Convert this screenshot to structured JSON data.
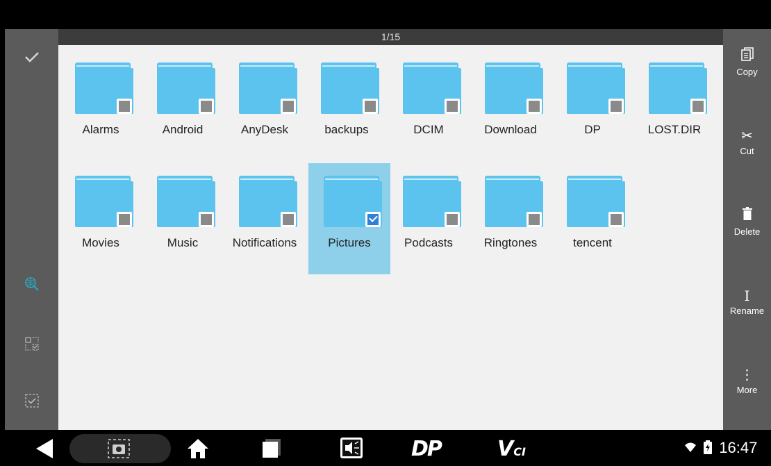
{
  "page_indicator": "1/15",
  "left_rail": {
    "select_all_icon": "checkmark-icon",
    "network_search_icon": "globe-search-icon",
    "select_mode_icon": "partial-select-icon",
    "checkbox_icon": "checkbox-icon"
  },
  "right_rail": {
    "copy": "Copy",
    "cut": "Cut",
    "delete": "Delete",
    "rename": "Rename",
    "more": "More"
  },
  "folders": [
    {
      "name": "Alarms",
      "checked": false
    },
    {
      "name": "Android",
      "checked": false
    },
    {
      "name": "AnyDesk",
      "checked": false
    },
    {
      "name": "backups",
      "checked": false
    },
    {
      "name": "DCIM",
      "checked": false
    },
    {
      "name": "Download",
      "checked": false
    },
    {
      "name": "DP",
      "checked": false
    },
    {
      "name": "LOST.DIR",
      "checked": false
    },
    {
      "name": "Movies",
      "checked": false
    },
    {
      "name": "Music",
      "checked": false
    },
    {
      "name": "Notifications",
      "checked": false
    },
    {
      "name": "Pictures",
      "checked": true
    },
    {
      "name": "Podcasts",
      "checked": false
    },
    {
      "name": "Ringtones",
      "checked": false
    },
    {
      "name": "tencent",
      "checked": false
    }
  ],
  "status": {
    "time": "16:47",
    "nav_logo_1": "DP",
    "nav_logo_2": "V",
    "nav_logo_2_sub": "CI"
  },
  "colors": {
    "folder": "#5bc3ee",
    "selection": "#8ecfea",
    "checkbox_checked": "#2f80d6"
  }
}
